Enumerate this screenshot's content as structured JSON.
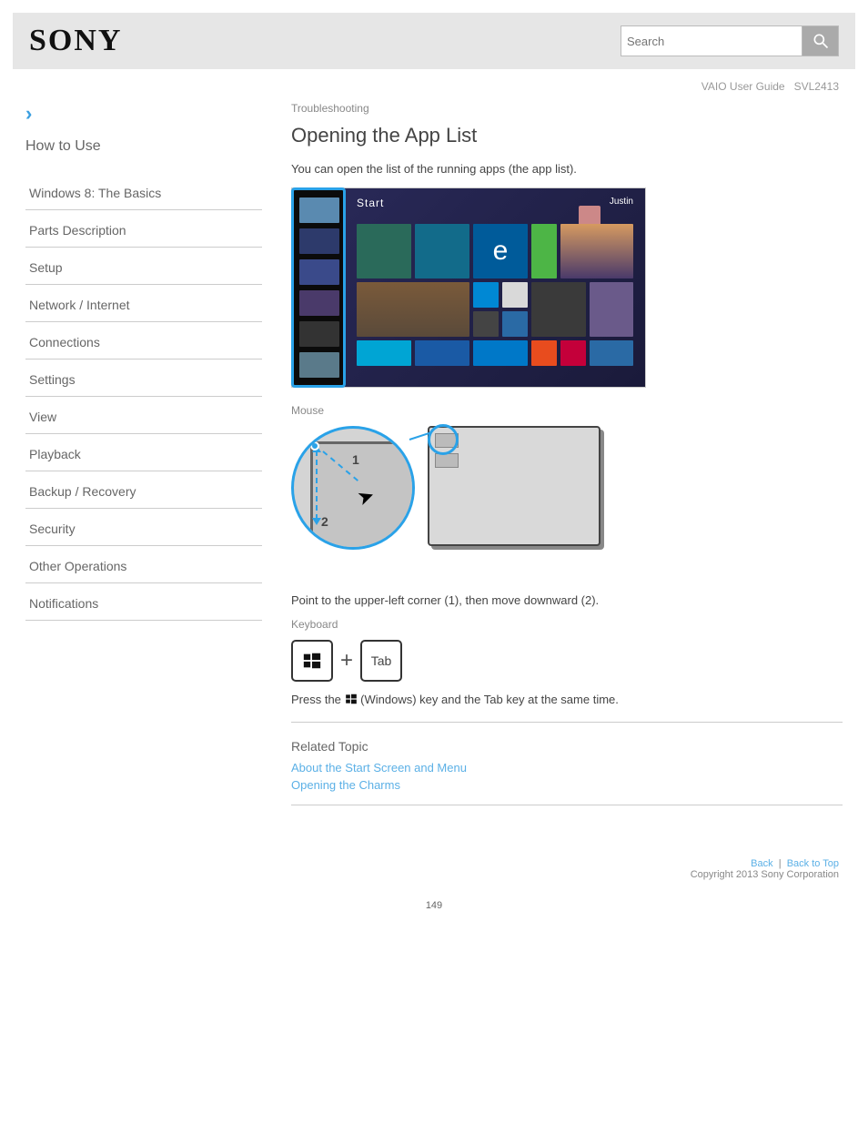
{
  "header": {
    "logo": "SONY",
    "search_placeholder": "Search"
  },
  "subheader": {
    "model_label": "VAIO User Guide",
    "model_name": "SVL2413"
  },
  "sidebar": {
    "howto": "How to Use",
    "items": [
      {
        "label": "Windows 8: The Basics"
      },
      {
        "label": "Parts Description"
      },
      {
        "label": "Setup"
      },
      {
        "label": "Network / Internet"
      },
      {
        "label": "Connections"
      },
      {
        "label": "Settings"
      },
      {
        "label": "View"
      },
      {
        "label": "Playback"
      },
      {
        "label": "Backup / Recovery"
      },
      {
        "label": "Security"
      },
      {
        "label": "Other Operations"
      },
      {
        "label": "Notifications"
      }
    ]
  },
  "main": {
    "breadcrumb": "Troubleshooting",
    "title": "Opening the App List",
    "intro": "You can open the list of the running apps (the app list).",
    "mouse_label": "Mouse",
    "mouse_text": "Point to the upper-left corner (1), then move downward (2).",
    "keyboard_label": "Keyboard",
    "keycap_tab": "Tab",
    "key_desc_prefix": "Press the ",
    "key_desc_suffix": " (Windows) key and the Tab key at the same time.",
    "related_title": "Related Topic",
    "related_links": [
      "About the Start Screen and Menu",
      "Opening the Charms"
    ]
  },
  "footer": {
    "back": "Back",
    "top": "Back to Top",
    "copyright": "Copyright 2013 Sony Corporation"
  },
  "page_number": "149"
}
